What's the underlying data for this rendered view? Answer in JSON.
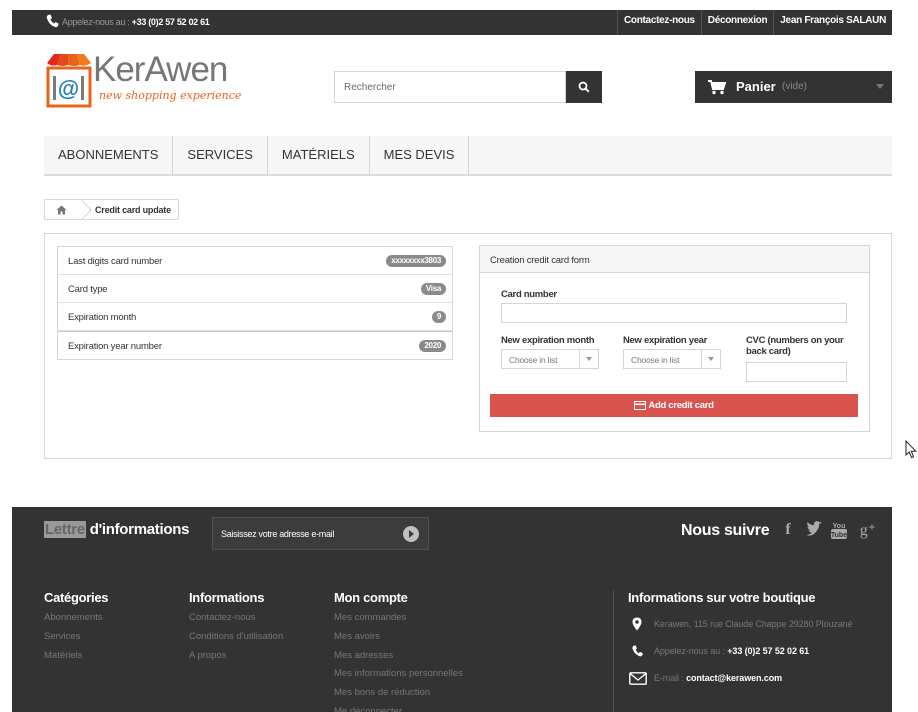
{
  "topbar": {
    "call_prefix": "Appelez-nous au :",
    "phone": "+33 (0)2 57 52 02 61",
    "links": [
      "Contactez-nous",
      "Déconnexion",
      "Jean François SALAUN"
    ]
  },
  "header": {
    "logo_brand": "KerAwen",
    "logo_tagline": "new shopping experience",
    "search_placeholder": "Rechercher",
    "cart_label": "Panier",
    "cart_status": "(vide)"
  },
  "nav": [
    "ABONNEMENTS",
    "SERVICES",
    "MATÉRIELS",
    "MES DEVIS"
  ],
  "breadcrumb": {
    "current": "Credit card update"
  },
  "card_info": [
    {
      "label": "Last digits card number",
      "value": "xxxxxxxx3803"
    },
    {
      "label": "Card type",
      "value": "Visa"
    },
    {
      "label": "Expiration month",
      "value": "9"
    },
    {
      "label": "Expiration year number",
      "value": "2020"
    }
  ],
  "form": {
    "title": "Creation credit card form",
    "card_number_label": "Card number",
    "month_label": "New expiration month",
    "year_label": "New expiration year",
    "cvc_label": "CVC (numbers on your back card)",
    "select_placeholder": "Choose in list",
    "submit_label": "Add credit card"
  },
  "newsletter": {
    "title_highlight": "Lettre",
    "title_rest": " d'informations",
    "email_placeholder": "Saisissez votre adresse e-mail",
    "follow_label": "Nous suivre",
    "social": [
      "facebook",
      "twitter",
      "youtube",
      "google-plus"
    ]
  },
  "footer": {
    "categories": {
      "title": "Catégories",
      "items": [
        "Abonnements",
        "Services",
        "Matériels"
      ]
    },
    "informations": {
      "title": "Informations",
      "items": [
        "Contactez-nous",
        "Conditions d'utilisation",
        "A propos"
      ]
    },
    "account": {
      "title": "Mon compte",
      "items": [
        "Mes commandes",
        "Mes avoirs",
        "Mes adresses",
        "Mes informations personnelles",
        "Mes bons de réduction",
        "Me déconnecter"
      ]
    },
    "store": {
      "title": "Informations sur votre boutique",
      "address": "Kerawen, 115 rue Claude Chappe 29280 Plouzané",
      "call_prefix": "Appelez-nous au :",
      "phone": "+33 (0)2 57 52 02 61",
      "email_prefix": "E-mail :",
      "email": "contact@kerawen.com"
    }
  },
  "colors": {
    "dark": "#333333",
    "accent_red": "#d9534f",
    "logo_orange": "#e8641a"
  }
}
